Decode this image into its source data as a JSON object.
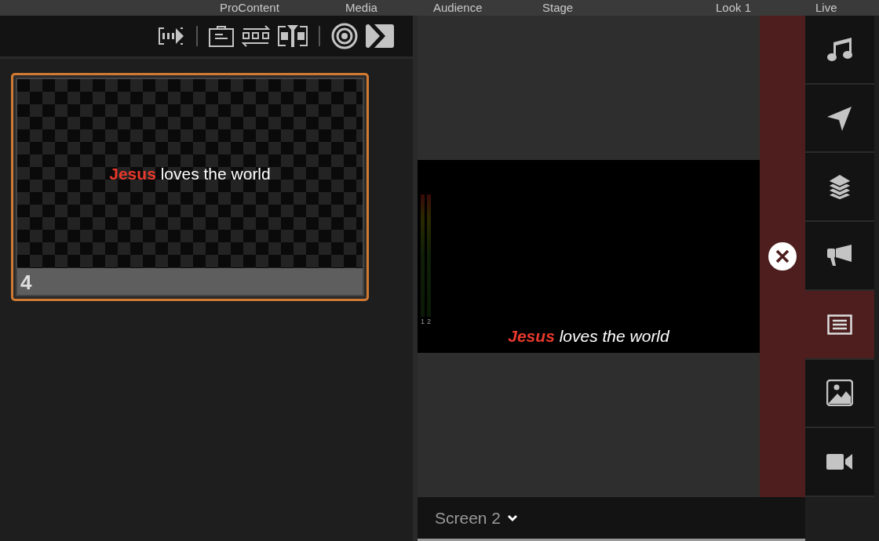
{
  "menu_bar": {
    "items": [
      {
        "label": "ProContent"
      },
      {
        "label": "Media"
      },
      {
        "label": "Audience"
      },
      {
        "label": "Stage"
      },
      {
        "label": "Look 1"
      },
      {
        "label": "Live"
      }
    ]
  },
  "toolbar": {
    "groups": [
      [
        {
          "kind": "slides"
        }
      ],
      [
        {
          "kind": "clipboard"
        },
        {
          "kind": "shuffle"
        },
        {
          "kind": "split"
        }
      ],
      [
        {
          "kind": "target"
        },
        {
          "kind": "forward"
        }
      ]
    ]
  },
  "slides": [
    {
      "text": "**Jesus** loves the world",
      "number": "4",
      "selected": true
    }
  ],
  "preview": {
    "text": "**Jesus** loves the world",
    "meters": [
      {
        "label": "1"
      },
      {
        "label": "2"
      }
    ]
  },
  "sidebar": {
    "items": [
      {
        "kind": "music",
        "selected": false
      },
      {
        "kind": "send",
        "selected": false
      },
      {
        "kind": "layers",
        "selected": false
      },
      {
        "kind": "announce",
        "selected": false
      },
      {
        "kind": "text",
        "selected": true
      },
      {
        "kind": "image",
        "selected": false
      },
      {
        "kind": "video",
        "selected": false
      }
    ]
  },
  "screen_selector": {
    "label": "Screen 2"
  }
}
